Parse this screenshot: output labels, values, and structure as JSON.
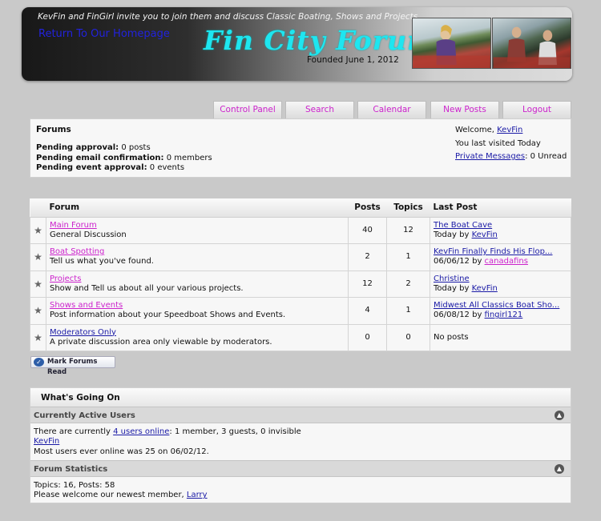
{
  "header": {
    "tagline": "KevFin and FinGirl invite you to join them and discuss Classic Boating, Shows and Projects.",
    "return_link": "Return To Our Homepage",
    "title": "Fin City Forum",
    "founded": "Founded June 1, 2012"
  },
  "nav": {
    "tabs": [
      "Control Panel",
      "Search",
      "Calendar",
      "New Posts",
      "Logout"
    ]
  },
  "info": {
    "title": "Forums",
    "pending": [
      {
        "label": "Pending approval:",
        "value": "0 posts"
      },
      {
        "label": "Pending email confirmation:",
        "value": "0 members"
      },
      {
        "label": "Pending event approval:",
        "value": "0 events"
      }
    ],
    "welcome_prefix": "Welcome,",
    "username": "KevFin",
    "last_visited": "You last visited Today",
    "pm_label": "Private Messages",
    "pm_value": ": 0 Unread"
  },
  "table": {
    "headers": {
      "forum": "Forum",
      "posts": "Posts",
      "topics": "Topics",
      "last_post": "Last Post"
    },
    "rows": [
      {
        "name": "Main Forum",
        "desc": "General Discussion",
        "posts": "40",
        "topics": "12",
        "last_title": "The Boat Cave",
        "last_when": "Today by",
        "last_by": "KevFin",
        "by_color": "blue"
      },
      {
        "name": "Boat Spotting",
        "desc": "Tell us what you've found.",
        "posts": "2",
        "topics": "1",
        "last_title": "KevFin Finally Finds His Flop...",
        "last_when": "06/06/12 by",
        "last_by": "canadafins",
        "by_color": "pink"
      },
      {
        "name": "Projects",
        "desc": "Show and Tell us about all your various projects.",
        "posts": "12",
        "topics": "2",
        "last_title": "Christine",
        "last_when": "Today by",
        "last_by": "KevFin",
        "by_color": "blue"
      },
      {
        "name": "Shows and Events",
        "desc": "Post information about your Speedboat Shows and Events.",
        "posts": "4",
        "topics": "1",
        "last_title": "Midwest All Classics Boat Sho...",
        "last_when": "06/08/12 by",
        "last_by": "fingirl121",
        "by_color": "blue"
      },
      {
        "name": "Moderators Only",
        "desc": "A private discussion area only viewable by moderators.",
        "posts": "0",
        "topics": "0",
        "last_title": "No posts",
        "last_when": "",
        "last_by": "",
        "by_color": "blue"
      }
    ]
  },
  "mark_read": "Mark Forums Read",
  "whats_going_on": {
    "title": "What's Going On",
    "active_users": {
      "heading": "Currently Active Users",
      "line1_prefix": "There are currently",
      "line1_link": "4 users online",
      "line1_suffix": ": 1 member, 3 guests, 0 invisible",
      "member": "KevFin",
      "record": "Most users ever online was 25 on 06/02/12."
    },
    "stats": {
      "heading": "Forum Statistics",
      "counts": "Topics: 16, Posts: 58",
      "newest_prefix": "Please welcome our newest member,",
      "newest_member": "Larry"
    }
  }
}
